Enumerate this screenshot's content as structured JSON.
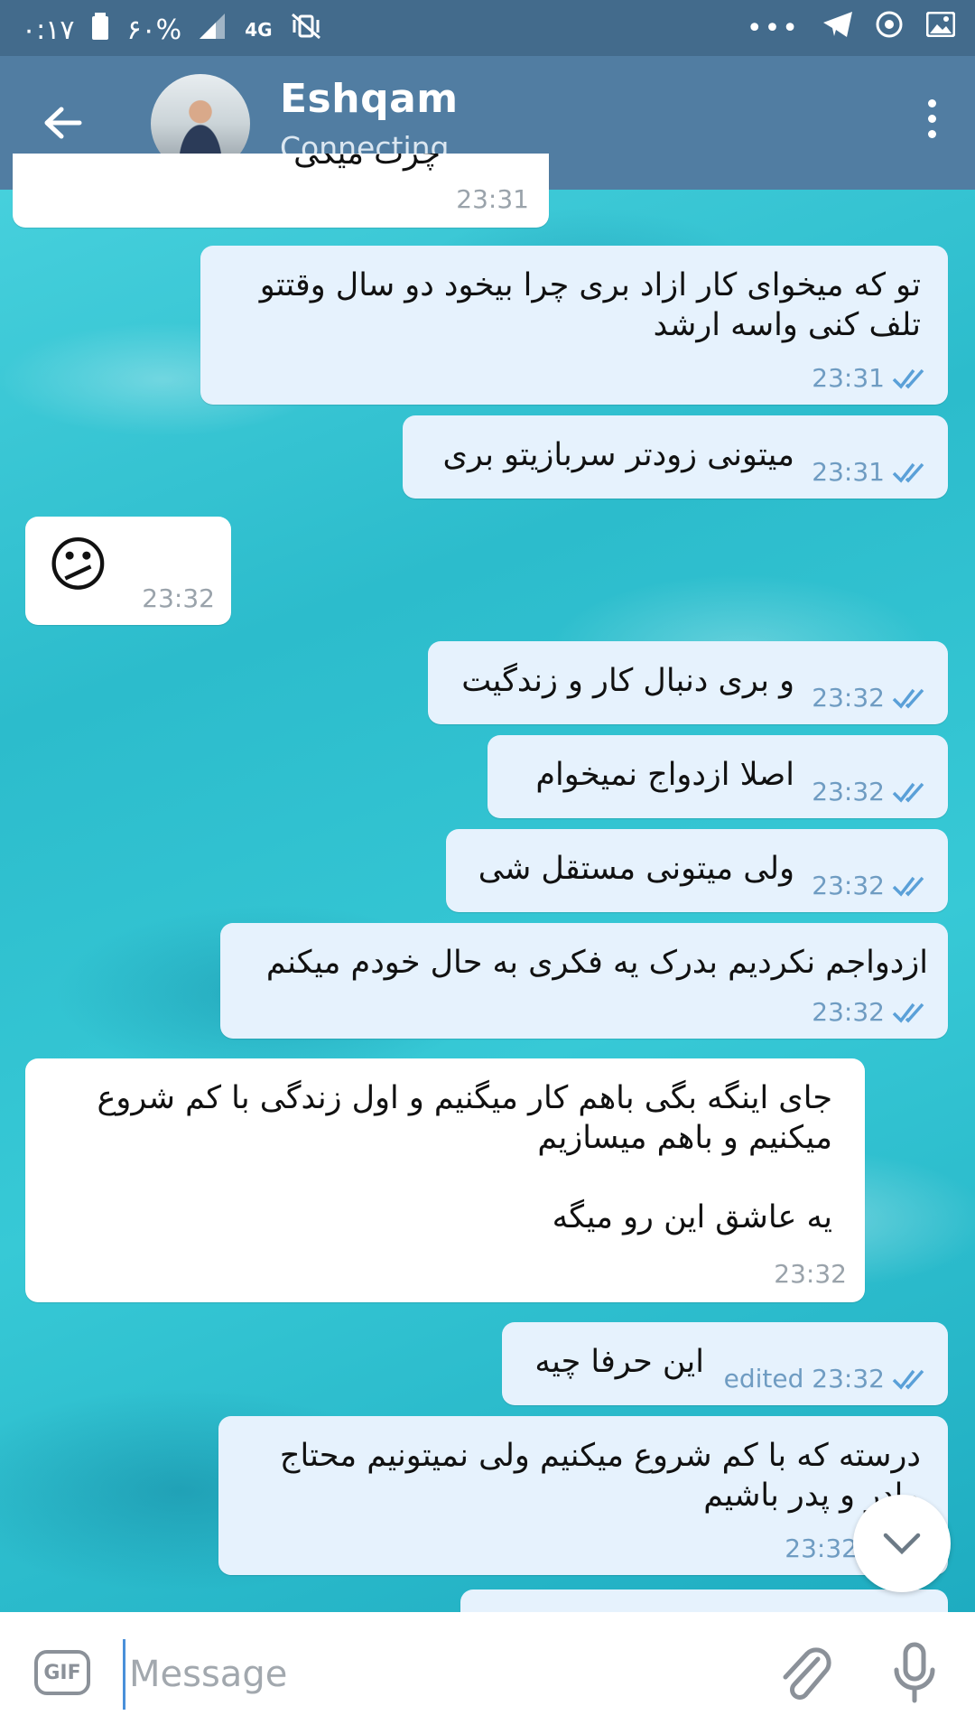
{
  "status_bar": {
    "time": "۰:۱۷",
    "battery": "۶۰%",
    "network": "4G"
  },
  "header": {
    "contact_name": "Eshqam",
    "connection_status": "Connecting..."
  },
  "messages": [
    {
      "dir": "in",
      "text": "چرت میگی",
      "time": "23:31"
    },
    {
      "dir": "out",
      "text": "تو که میخوای کار ازاد بری چرا بیخود دو سال وقتتو\nتلف کنی واسه ارشد",
      "time": "23:31"
    },
    {
      "dir": "out",
      "text": "میتونی زودتر سربازیتو بری",
      "time": "23:31"
    },
    {
      "dir": "in",
      "text": "😕",
      "time": "23:32"
    },
    {
      "dir": "out",
      "text": "و بری دنبال کار و زندگیت",
      "time": "23:32"
    },
    {
      "dir": "out",
      "text": "اصلا ازدواج نمیخوام",
      "time": "23:32"
    },
    {
      "dir": "out",
      "text": "ولی میتونی مستقل شی",
      "time": "23:32"
    },
    {
      "dir": "out",
      "text": "ازدواجم نکردیم بدرک یه فکری به حال خودم میکنم",
      "time": "23:32"
    },
    {
      "dir": "in",
      "text": "جای اینگه بگی باهم کار میگنیم و اول زندگی با کم شروع\nمیکنیم و باهم میسازیم\n\nیه عاشق این رو میگه",
      "time": "23:32"
    },
    {
      "dir": "out",
      "text": "این حرفا چیه",
      "time": "edited 23:32"
    },
    {
      "dir": "out",
      "text": "درسته که با کم شروع میکنیم ولی نمیتونیم محتاج\nمادر و پدر باشیم",
      "time": "23:32"
    }
  ],
  "input": {
    "gif_label": "GIF",
    "placeholder": "Message"
  },
  "colors": {
    "header": "#517da2",
    "status_bar": "#436b8c",
    "outgoing_bubble": "#e6f2fd",
    "incoming_bubble": "#ffffff",
    "tick_blue": "#5aa0d8"
  },
  "icons": [
    "back-arrow-icon",
    "more-vert-icon",
    "double-check-icon",
    "gif-icon",
    "paperclip-icon",
    "microphone-icon",
    "chevron-down-icon"
  ]
}
